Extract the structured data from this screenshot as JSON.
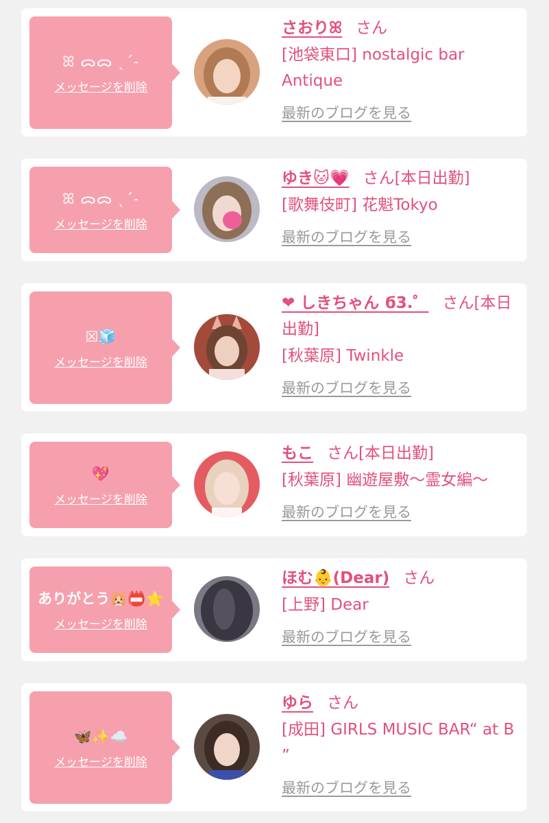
{
  "items": [
    {
      "message": "ꕤ ᯅᯅ ˎˊ˗",
      "delete_label": "メッセージを削除",
      "name": "さおりꕤ",
      "suffix": "さん",
      "shop": "[池袋東口] nostalgic bar Antique",
      "blog_label": "最新のブログを見る",
      "avatar": {
        "bg": "#d9a27f",
        "hair": "#b07a52",
        "skin": "#f4d5c2"
      }
    },
    {
      "message": "ꕤ ᯅᯅ ˎˊ˗",
      "delete_label": "メッセージを削除",
      "name": "ゆき🐱💗",
      "suffix": "さん[本日出勤]",
      "shop": "[歌舞伎町] 花魁Tokyo",
      "blog_label": "最新のブログを見る",
      "avatar": {
        "bg": "#bcb8c4",
        "hair": "#8c6f56",
        "skin": "#f0dad0",
        "sticker": "#ee5f9a"
      }
    },
    {
      "message": "☒🧊",
      "delete_label": "メッセージを削除",
      "name": "❤ しきちゃん ϭ3.゜",
      "suffix": "さん[本日出勤]",
      "shop": "[秋葉原] Twinkle",
      "blog_label": "最新のブログを見る",
      "avatar": {
        "bg": "#a34a3a",
        "hair": "#6e4433",
        "skin": "#efd0c0"
      }
    },
    {
      "message": "💖",
      "delete_label": "メッセージを削除",
      "name": "もこ",
      "suffix": "さん[本日出勤]",
      "shop": "[秋葉原] 幽遊屋敷〜霊女編〜",
      "blog_label": "最新のブログを見る",
      "avatar": {
        "bg": "#e45c62",
        "hair": "#e8d2bd",
        "skin": "#f7dfd5"
      }
    },
    {
      "message": "ありがとう🐹📛⭐",
      "delete_label": "メッセージを削除",
      "name": "ほむ👶(Dear)",
      "suffix": "さん",
      "shop": "[上野] Dear",
      "blog_label": "最新のブログを見る",
      "avatar": {
        "bg": "#7a7882",
        "hair": "#3a3642",
        "skin": "#55525d"
      }
    },
    {
      "message": "🦋✨☁️",
      "delete_label": "メッセージを削除",
      "name": "ゆら",
      "suffix": "さん",
      "shop": "[成田] GIRLS MUSIC BAR“ at B ”",
      "blog_label": "最新のブログを見る",
      "avatar": {
        "bg": "#5a4a42",
        "hair": "#3c2c25",
        "skin": "#f0d6c8",
        "accent": "#3b50a8"
      }
    }
  ]
}
